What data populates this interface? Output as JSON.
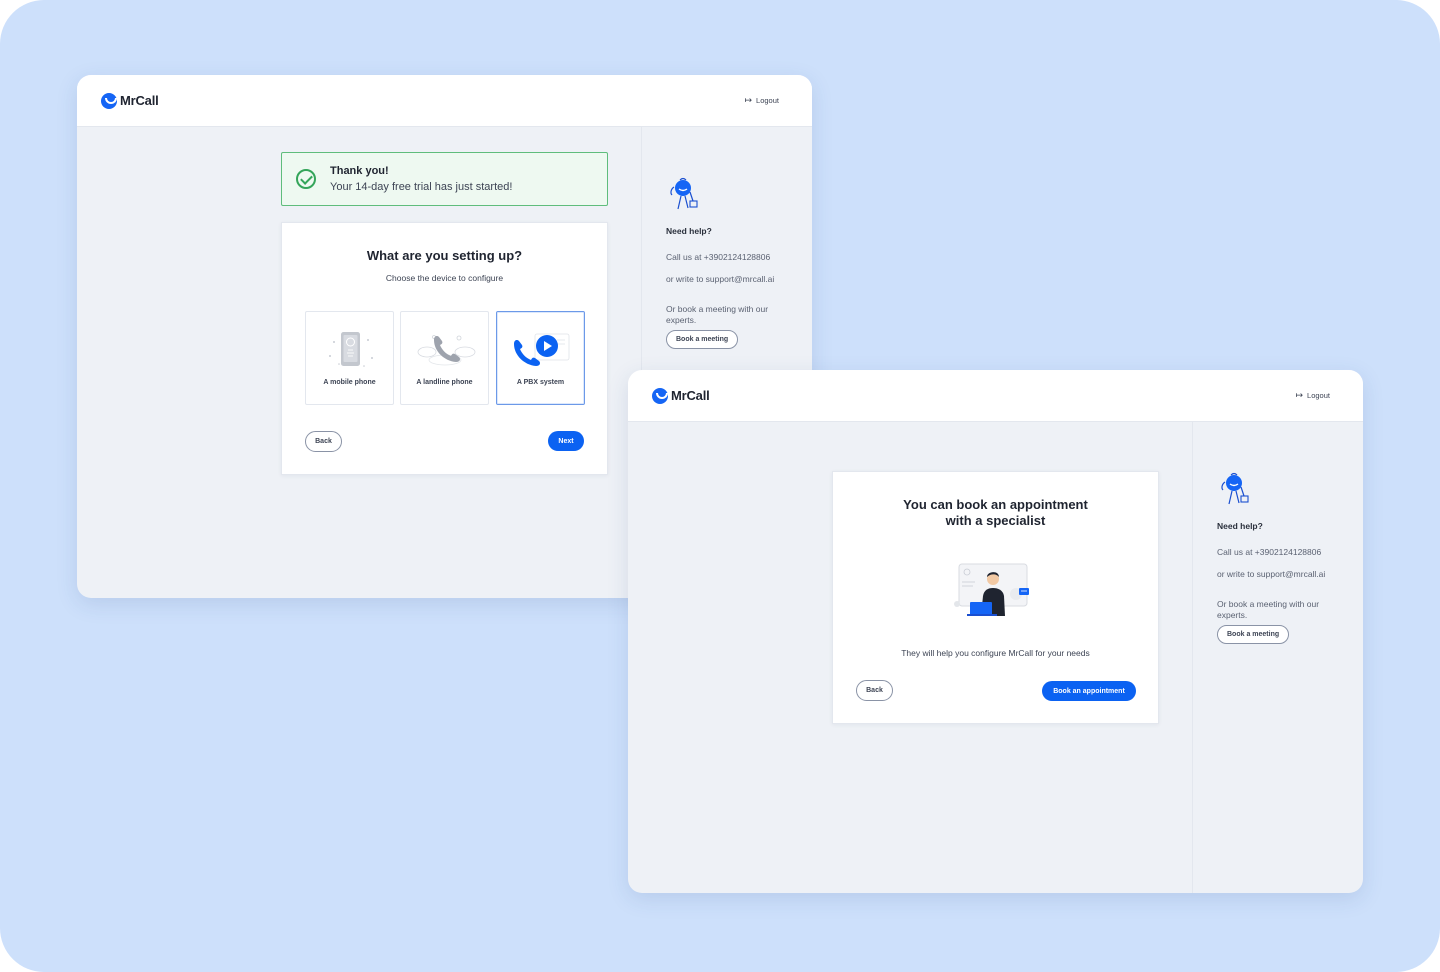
{
  "brand": {
    "name": "MrCall",
    "accent": "#0b62f2",
    "success": "#34a55a"
  },
  "header": {
    "logout_label": "Logout"
  },
  "sidebar": {
    "title": "Need help?",
    "call_text": "Call us at +3902124128806",
    "write_text": "or write to support@mrcall.ai",
    "meeting_text": "Or book a meeting with our experts.",
    "book_meeting_label": "Book a meeting"
  },
  "screen_device": {
    "notice": {
      "title": "Thank you!",
      "subtitle": "Your 14-day free trial has just started!"
    },
    "title": "What are you setting up?",
    "subtitle": "Choose the device to configure",
    "options": [
      {
        "label": "A mobile phone",
        "icon": "mobile-phone-icon",
        "selected": false
      },
      {
        "label": "A landline phone",
        "icon": "landline-phone-icon",
        "selected": false
      },
      {
        "label": "A PBX system",
        "icon": "pbx-system-icon",
        "selected": true
      }
    ],
    "back_label": "Back",
    "next_label": "Next"
  },
  "screen_appointment": {
    "title_line1": "You can book an appointment",
    "title_line2": "with a specialist",
    "description": "They will help you configure MrCall for your needs",
    "back_label": "Back",
    "book_label": "Book an appointment"
  }
}
